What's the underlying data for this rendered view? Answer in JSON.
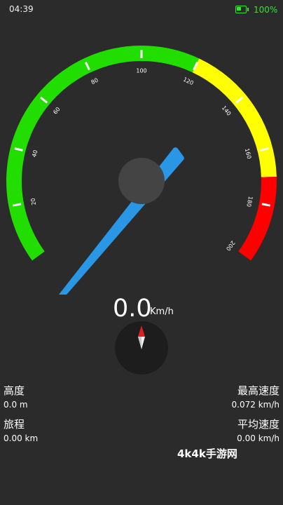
{
  "status": {
    "time": "04:39",
    "battery": "100%"
  },
  "speedometer": {
    "ticks": [
      "20",
      "40",
      "60",
      "80",
      "100",
      "120",
      "140",
      "160",
      "180",
      "200"
    ],
    "colors": {
      "green": "#22dd00",
      "yellow": "#ffff00",
      "red": "#ff0000",
      "needle": "#2a96e6",
      "hub": "#444444"
    }
  },
  "speed": {
    "value": "0.0",
    "unit": "Km/h"
  },
  "stats": {
    "altitude_label": "高度",
    "altitude_value": "0.0 m",
    "trip_label": "旅程",
    "trip_value": "0.00 km",
    "max_speed_label": "最高速度",
    "max_speed_value": "0.072 km/h",
    "avg_speed_label": "平均速度",
    "avg_speed_value": "0.00 km/h"
  },
  "watermark": "4k4k手游网"
}
